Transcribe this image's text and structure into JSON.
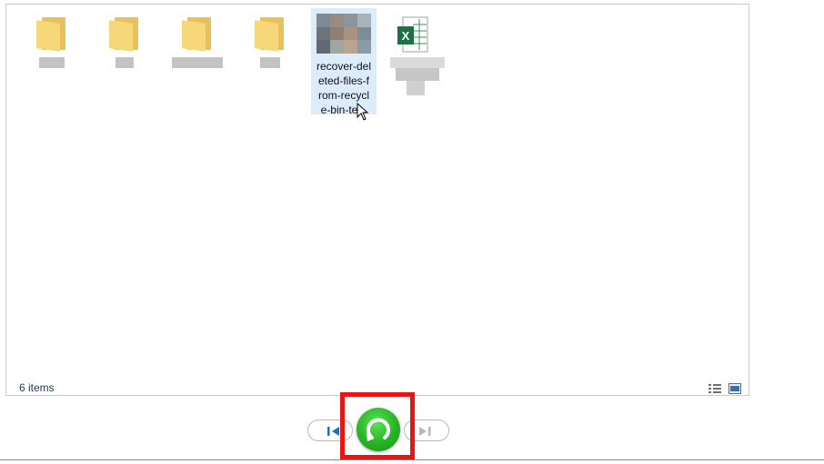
{
  "explorer": {
    "status_text": "6 items",
    "selected_file_label": "recover-del\neted-files-f\nrom-recycl\ne-bin-te..."
  },
  "icons": {
    "folder": "folder-icon",
    "excel": "excel-file-icon",
    "image": "image-thumbnail-icon",
    "details_view": "details-view-icon",
    "large_icons_view": "large-icons-view-icon",
    "previous": "previous-icon",
    "play": "play-slideshow-icon",
    "next": "next-icon"
  },
  "colors": {
    "selection": "#dcecfb",
    "highlight_box": "#e81515",
    "play_button": "#28b325",
    "excel_green": "#1e7145"
  }
}
